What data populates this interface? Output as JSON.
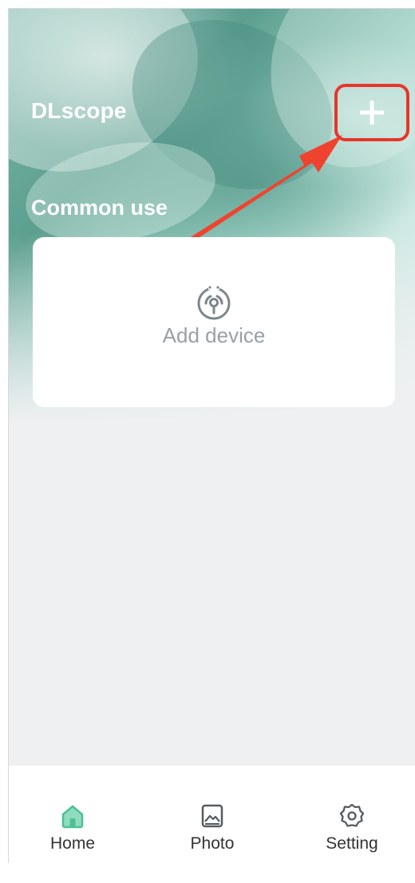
{
  "header": {
    "app_title": "DLscope",
    "add_icon": "plus-icon"
  },
  "section": {
    "title": "Common use"
  },
  "device_card": {
    "icon": "wireless-signal-icon",
    "label": "Add device"
  },
  "tabs": [
    {
      "label": "Home",
      "icon": "home-icon",
      "active": true
    },
    {
      "label": "Photo",
      "icon": "photo-icon",
      "active": false
    },
    {
      "label": "Setting",
      "icon": "gear-icon",
      "active": false
    }
  ],
  "colors": {
    "accent_green": "#5dc9a0",
    "highlight_red": "#e7362b",
    "background": "#eff0f2",
    "muted_text": "#9aa0a6"
  }
}
